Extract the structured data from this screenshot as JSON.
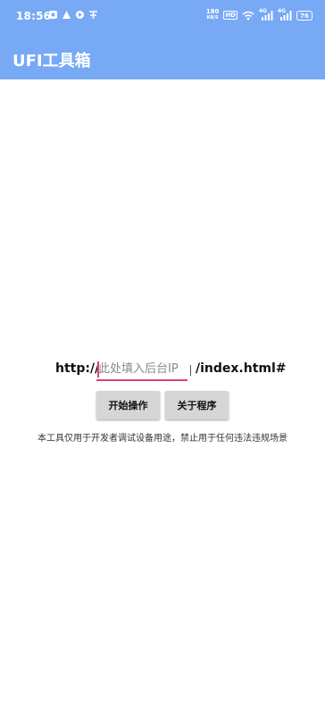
{
  "status_bar": {
    "time": "18:56",
    "left_icons": [
      "notification-icon",
      "app-icon",
      "sync-icon",
      "cast-icon"
    ],
    "speed_top": "180",
    "speed_bottom": "KB/S",
    "hd_label": "HD",
    "signal1_label": "4G",
    "signal2_label": "4G",
    "battery_level": "76"
  },
  "app_bar": {
    "title": "UFI工具箱"
  },
  "form": {
    "prefix": "http://",
    "ip_placeholder": "此处填入后台IP",
    "ip_value": "",
    "suffix": "/index.html#"
  },
  "buttons": {
    "start_label": "开始操作",
    "about_label": "关于程序"
  },
  "notice": "本工具仅用于开发者调试设备用途，禁止用于任何违法违规场景",
  "colors": {
    "header": "#77a9f5",
    "input_underline": "#d9447a",
    "button_bg": "#d6d6d6"
  }
}
